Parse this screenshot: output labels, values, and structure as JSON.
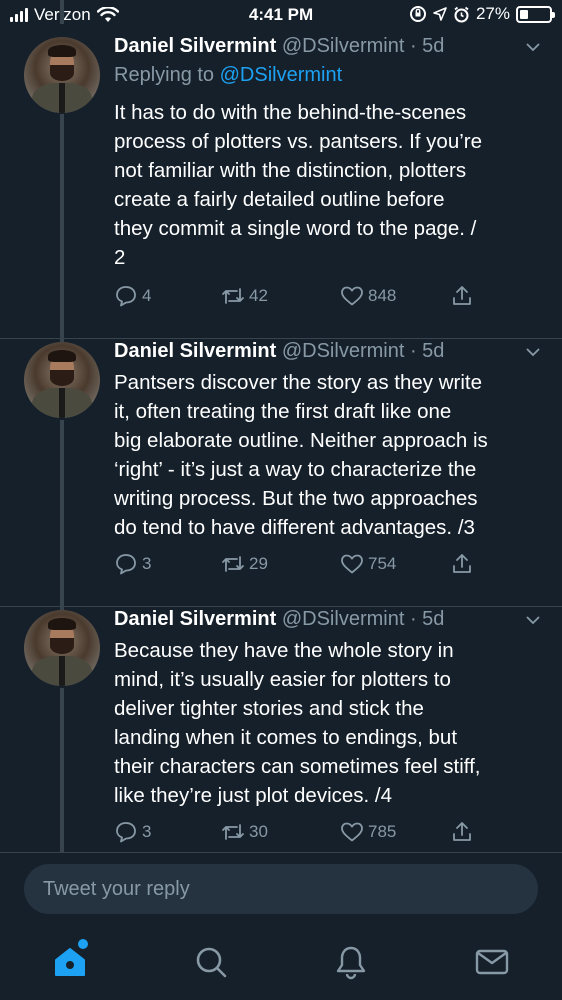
{
  "status": {
    "carrier": "Verizon",
    "time": "4:41 PM",
    "battery": "27%",
    "battery_level": 0.27
  },
  "tweets": [
    {
      "name": "Daniel Silvermint",
      "handle": "@DSilvermint",
      "age": "· 5d",
      "replying_label": "Replying to ",
      "replying_to": "@DSilvermint",
      "text": "It has to do with the behind-the-scenes\nprocess of plotters vs. pantsers. If you’re\nnot familiar with the distinction, plotters\ncreate a fairly detailed outline before\nthey commit a single word to the page.  /\n2",
      "replies": "4",
      "retweets": "42",
      "likes": "848"
    },
    {
      "name": "Daniel Silvermint",
      "handle": "@DSilvermint",
      "age": "· 5d",
      "text": "Pantsers discover the story as they write\nit, often treating the first draft like one\nbig elaborate outline. Neither approach is\n‘right’ - it’s just a way to characterize the\nwriting process. But the two approaches\ndo tend to have different advantages.  /3",
      "replies": "3",
      "retweets": "29",
      "likes": "754"
    },
    {
      "name": "Daniel Silvermint",
      "handle": "@DSilvermint",
      "age": "· 5d",
      "text": "Because they have the whole story in\nmind, it’s usually easier for plotters to\ndeliver tighter stories and stick the\nlanding when it comes to endings, but\ntheir characters can sometimes feel stiff,\nlike they’re just plot devices.  /4",
      "replies": "3",
      "retweets": "30",
      "likes": "785"
    }
  ],
  "reply_bar": {
    "placeholder": "Tweet your reply"
  },
  "tabbar": {
    "items": [
      "home-icon",
      "search-icon",
      "notifications-icon",
      "messages-icon"
    ],
    "active": "home-icon"
  },
  "colors": {
    "background": "#15202b",
    "accent": "#1da1f2",
    "secondary_text": "#8899a6",
    "divider": "#38444d"
  }
}
